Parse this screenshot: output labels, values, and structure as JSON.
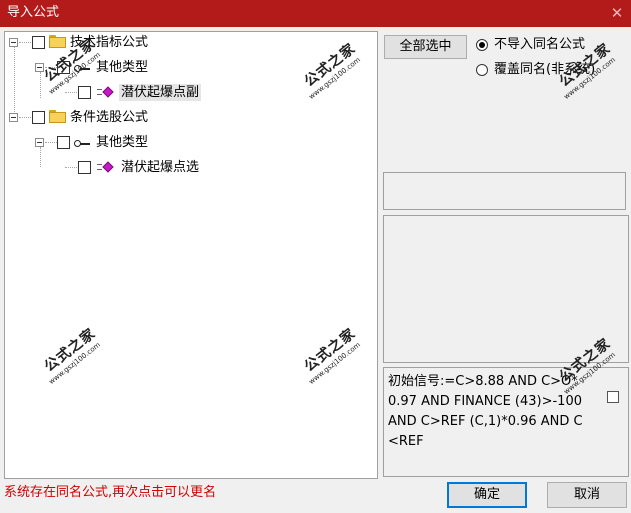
{
  "window": {
    "title": "导入公式",
    "close_glyph": "✕"
  },
  "tree": {
    "nodes": [
      {
        "label": "技术指标公式",
        "icon": "folder-icon"
      },
      {
        "label": "其他类型",
        "icon": "key-icon"
      },
      {
        "label": "潜伏起爆点副",
        "icon": "gem-icon",
        "selected": true
      },
      {
        "label": "条件选股公式",
        "icon": "folder-icon"
      },
      {
        "label": "其他类型",
        "icon": "key-icon"
      },
      {
        "label": "潜伏起爆点选",
        "icon": "gem-icon"
      }
    ]
  },
  "options": {
    "select_all_label": "全部选中",
    "radio_skip_label": "不导入同名公式",
    "radio_overwrite_label": "覆盖同名(非系统)",
    "selected_radio": "skip"
  },
  "formula_text": "初始信号:=C>8.88 AND C>O*0.97 AND FINANCE (43)>-100 AND C>REF (C,1)*0.96 AND C<REF",
  "status_message": "系统存在同名公式,再次点击可以更名",
  "buttons": {
    "ok_label": "确定",
    "cancel_label": "取消"
  },
  "watermark": {
    "cn": "公式之家",
    "url": "www.gszj100.com"
  },
  "colors": {
    "titlebar": "#b31b1b",
    "status_text": "#d00000"
  }
}
